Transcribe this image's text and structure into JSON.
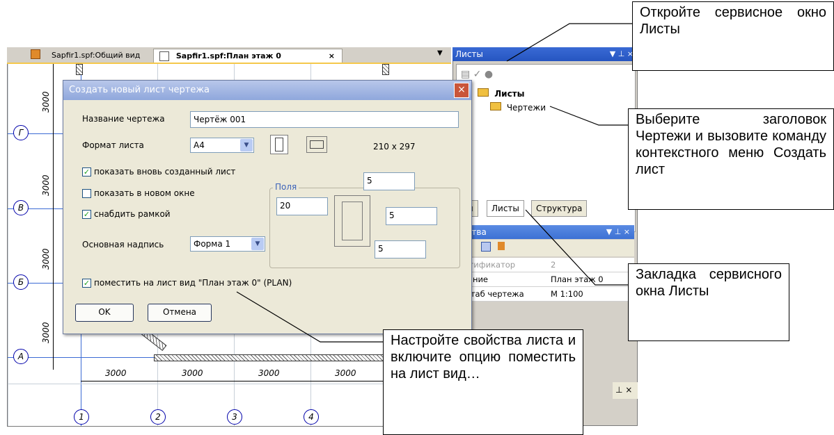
{
  "tabs": {
    "tab1": "Sapfir1.spf:Общий вид",
    "tab2": "Sapfir1.spf:План этаж 0",
    "tab2_close": "×",
    "menu_arrow": "▼"
  },
  "drawing": {
    "axes_v": [
      "1",
      "2",
      "3",
      "4"
    ],
    "axes_h": [
      "Г",
      "В",
      "Б",
      "А"
    ],
    "dim": "3000"
  },
  "sheets_panel": {
    "title": "Листы",
    "title_controls": "▼ ⊥ ×",
    "tree_root": "Листы",
    "tree_child": "Чертежи",
    "tabs": [
      "ды",
      "Листы",
      "Структура"
    ]
  },
  "props_panel": {
    "title": "йства",
    "title_controls": "▼ ⊥ ×",
    "rows": [
      {
        "name": "ентификатор",
        "value": "2"
      },
      {
        "name": "звание",
        "value": "План этаж 0"
      },
      {
        "name": "сштаб чертежа",
        "value": "М 1:100"
      }
    ],
    "bottom_controls": "⊥ ×"
  },
  "dialog": {
    "title": "Создать новый лист чертежа",
    "close": "×",
    "name_label": "Название чертежа",
    "name_value": "Чертёж 001",
    "format_label": "Формат листа",
    "format_value": "A4",
    "format_size": "210 x 297",
    "cb_show_new": "показать вновь созданный лист",
    "cb_new_window": "показать в новом окне",
    "cb_frame": "снабдить рамкой",
    "fields_label": "Поля",
    "field_top": "5",
    "field_left": "20",
    "field_right": "5",
    "field_bottom": "5",
    "stamp_label": "Основная надпись",
    "stamp_value": "Форма 1",
    "cb_place_view": "поместить на лист вид  \"План этаж 0\" (PLAN)",
    "ok": "OK",
    "cancel": "Отмена",
    "check_mark": "✓"
  },
  "notes": {
    "note1": "Откройте сервисное окно Листы",
    "note2": "Выберите заголовок Чертежи и вызовите команду контекстного меню Создать лист",
    "note3": "Закладка сервисного окна Листы",
    "note4": "Настройте свойства листа и включите опцию поместить на лист вид…"
  }
}
